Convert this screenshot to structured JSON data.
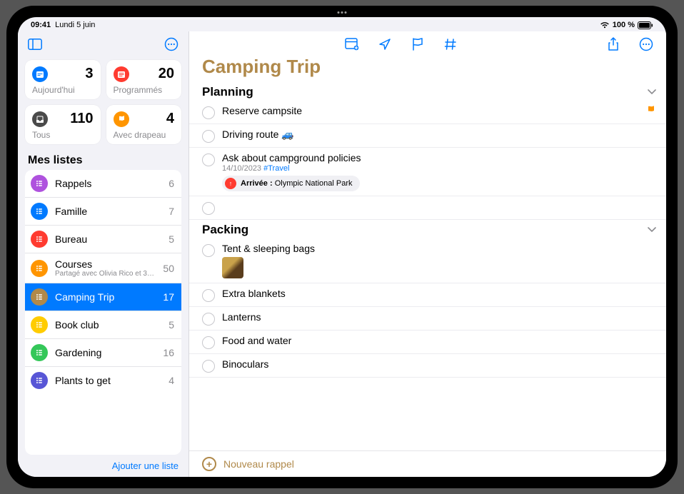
{
  "status": {
    "time": "09:41",
    "date": "Lundi 5 juin",
    "battery_text": "100 %"
  },
  "sidebar": {
    "smart": [
      {
        "label": "Aujourd'hui",
        "count": "3",
        "color": "#007aff",
        "icon": "calendar"
      },
      {
        "label": "Programmés",
        "count": "20",
        "color": "#ff3b30",
        "icon": "calendar-lines"
      },
      {
        "label": "Tous",
        "count": "110",
        "color": "#4a4a4a",
        "icon": "tray"
      },
      {
        "label": "Avec drapeau",
        "count": "4",
        "color": "#ff9500",
        "icon": "flag"
      }
    ],
    "header": "Mes listes",
    "lists": [
      {
        "name": "Rappels",
        "count": "6",
        "color": "#af52de",
        "selected": false
      },
      {
        "name": "Famille",
        "count": "7",
        "color": "#007aff",
        "selected": false
      },
      {
        "name": "Bureau",
        "count": "5",
        "color": "#ff3b30",
        "selected": false
      },
      {
        "name": "Courses",
        "count": "50",
        "color": "#ff9500",
        "selected": false,
        "subtext": "Partagé avec Olivia Rico et 3…"
      },
      {
        "name": "Camping Trip",
        "count": "17",
        "color": "#b0894a",
        "selected": true
      },
      {
        "name": "Book club",
        "count": "5",
        "color": "#ffcc00",
        "selected": false
      },
      {
        "name": "Gardening",
        "count": "16",
        "color": "#34c759",
        "selected": false
      },
      {
        "name": "Plants to get",
        "count": "4",
        "color": "#5856d6",
        "selected": false
      }
    ],
    "add_list": "Ajouter une liste"
  },
  "main": {
    "title": "Camping Trip",
    "groups": [
      {
        "name": "Planning",
        "items": [
          {
            "title": "Reserve campsite",
            "flagged": true
          },
          {
            "title": "Driving route 🚙"
          },
          {
            "title": "Ask about campground policies",
            "date": "14/10/2023",
            "tag": "#Travel",
            "location_prefix": "Arrivée : ",
            "location_name": "Olympic National Park"
          },
          {
            "title": ""
          }
        ]
      },
      {
        "name": "Packing",
        "items": [
          {
            "title": "Tent & sleeping bags",
            "has_thumb": true
          },
          {
            "title": "Extra blankets"
          },
          {
            "title": "Lanterns"
          },
          {
            "title": "Food and water"
          },
          {
            "title": "Binoculars"
          }
        ]
      }
    ],
    "new_reminder": "Nouveau rappel"
  }
}
